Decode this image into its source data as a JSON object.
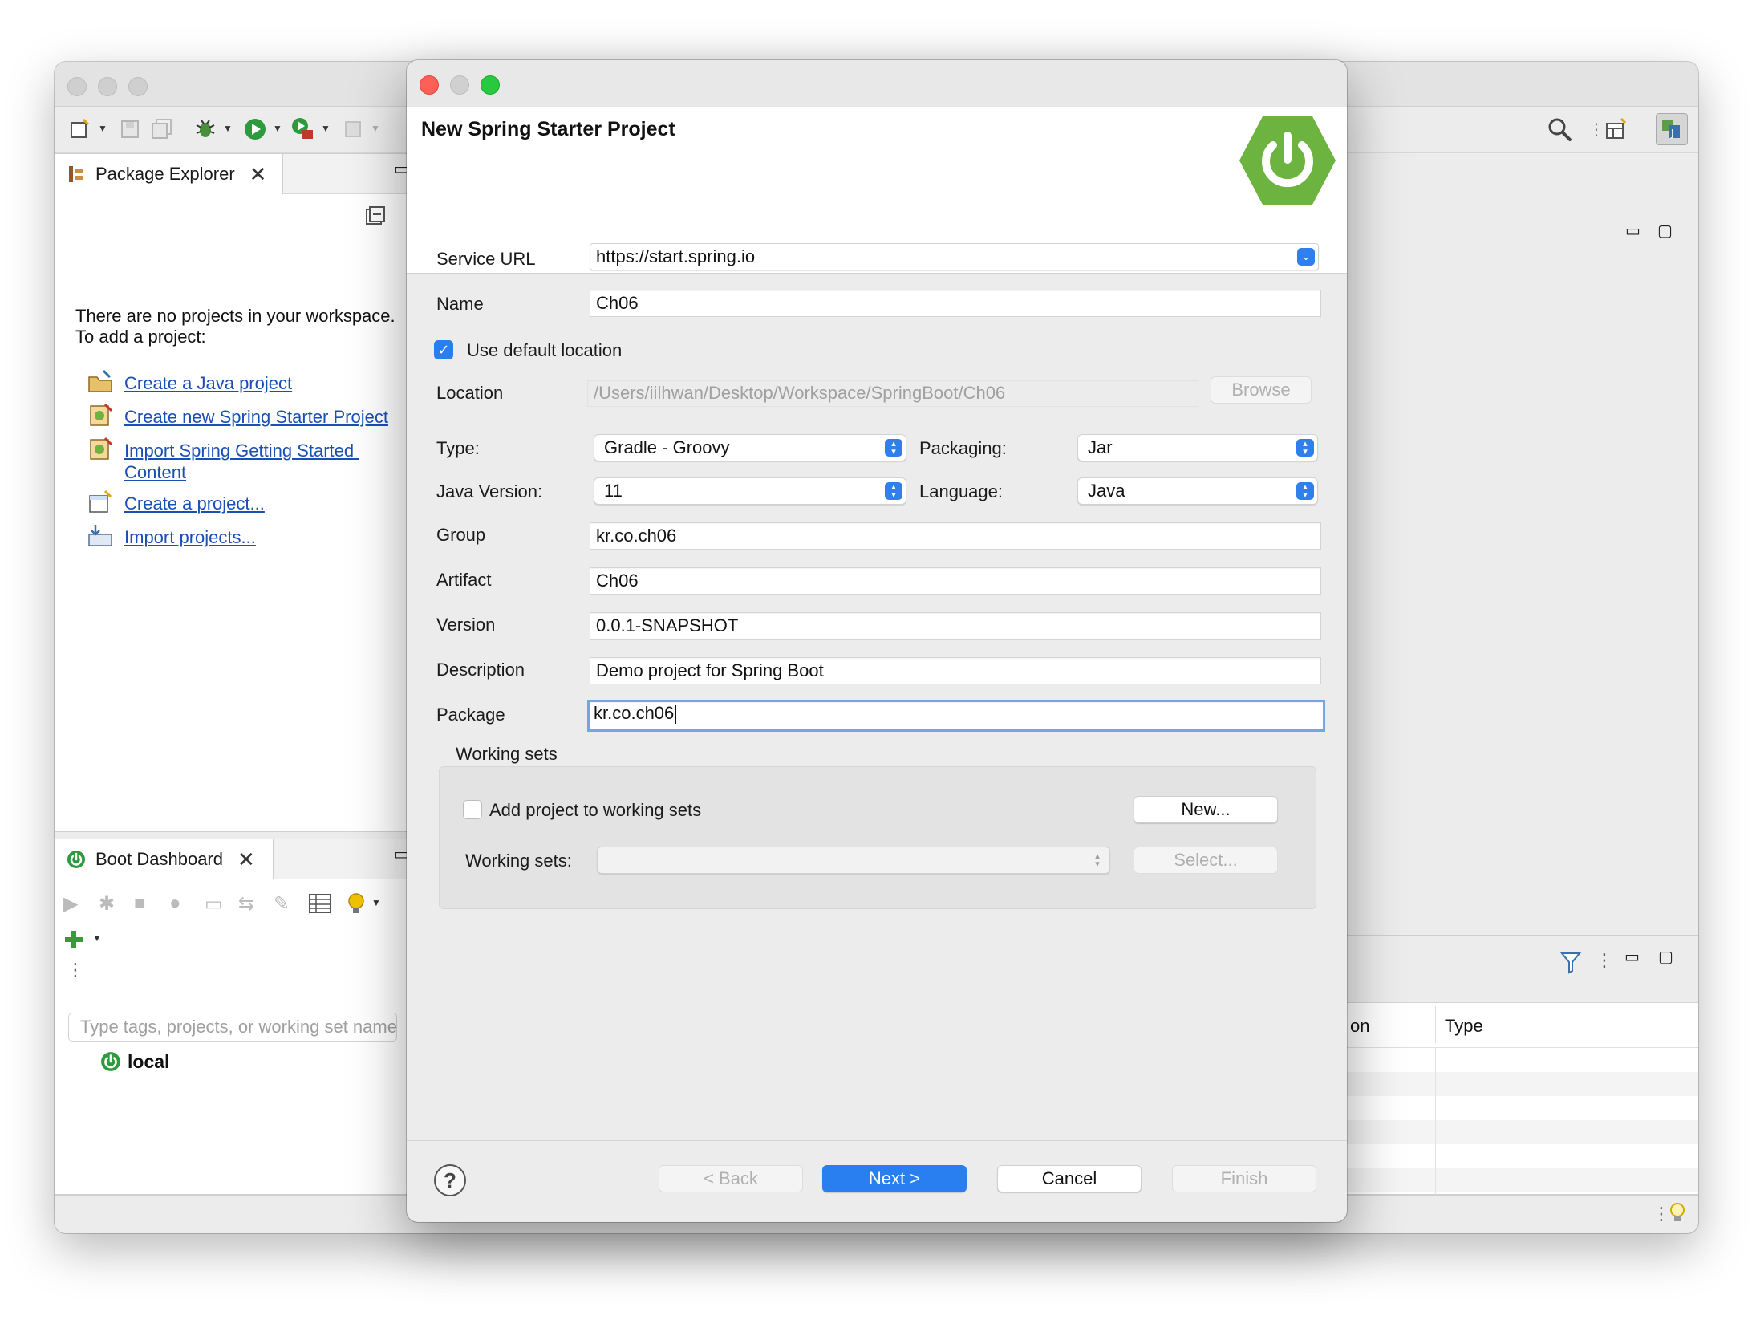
{
  "ide": {
    "package_explorer": {
      "tab_label": "Package Explorer",
      "empty_message_line1": "There are no projects in your workspace.",
      "empty_message_line2": "To add a project:",
      "links": [
        {
          "label": "Create a Java project"
        },
        {
          "label": "Create new Spring Starter Project"
        },
        {
          "label_line1": "Import Spring Getting Started ",
          "label_line2": "Content"
        },
        {
          "label": "Create a project..."
        },
        {
          "label": "Import projects..."
        }
      ]
    },
    "boot_dashboard": {
      "tab_label": "Boot Dashboard",
      "filter_placeholder": "Type tags, projects, or working set names",
      "tree_root": "local"
    },
    "bottom_table": {
      "columns": [
        "on",
        "Type"
      ]
    }
  },
  "dialog": {
    "title": "New Spring Starter Project",
    "service_url": {
      "label": "Service URL",
      "value": "https://start.spring.io"
    },
    "name": {
      "label": "Name",
      "value": "Ch06"
    },
    "use_default_location": {
      "label": "Use default location",
      "checked": true
    },
    "location": {
      "label": "Location",
      "value": "/Users/iilhwan/Desktop/Workspace/SpringBoot/Ch06",
      "browse_label": "Browse"
    },
    "type": {
      "label": "Type:",
      "value": "Gradle - Groovy"
    },
    "packaging": {
      "label": "Packaging:",
      "value": "Jar"
    },
    "java_version": {
      "label": "Java Version:",
      "value": "11"
    },
    "language": {
      "label": "Language:",
      "value": "Java"
    },
    "group": {
      "label": "Group",
      "value": "kr.co.ch06"
    },
    "artifact": {
      "label": "Artifact",
      "value": "Ch06"
    },
    "version": {
      "label": "Version",
      "value": "0.0.1-SNAPSHOT"
    },
    "description": {
      "label": "Description",
      "value": "Demo project for Spring Boot"
    },
    "package": {
      "label": "Package",
      "value": "kr.co.ch06"
    },
    "working_sets": {
      "section_label": "Working sets",
      "add_label": "Add project to working sets",
      "add_checked": false,
      "new_button": "New...",
      "sets_label": "Working sets:",
      "select_button": "Select..."
    },
    "footer": {
      "help": "?",
      "back": "< Back",
      "next": "Next >",
      "cancel": "Cancel",
      "finish": "Finish"
    }
  },
  "colors": {
    "accent": "#2a7ff0",
    "link": "#1a4fb5",
    "spring_green": "#6db33f",
    "close_red": "#fe5f57",
    "minimize_yellow": "#febc2e",
    "zoom_green": "#28c840"
  }
}
